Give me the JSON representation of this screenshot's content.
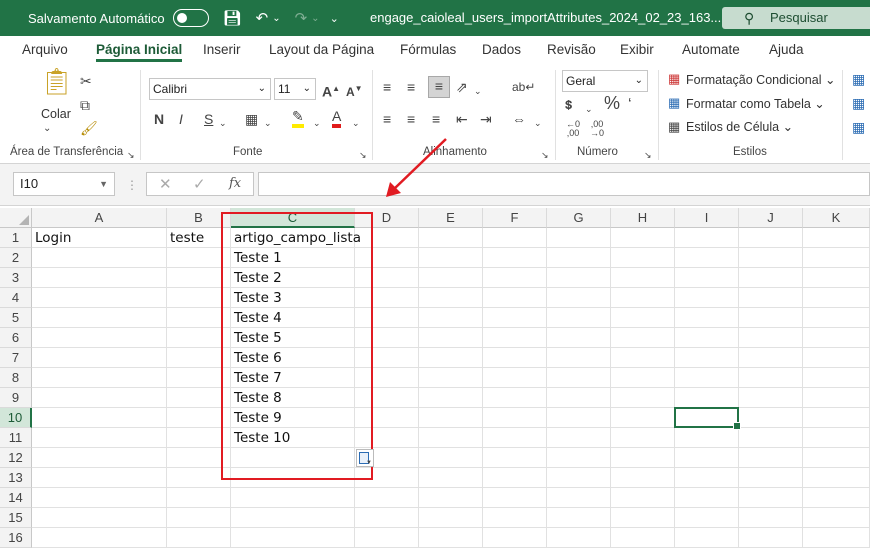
{
  "titlebar": {
    "autosave_label": "Salvamento Automático",
    "doc_title": "engage_caioleal_users_importAttributes_2024_02_23_163...",
    "search_placeholder": "Pesquisar",
    "color": "#217346"
  },
  "menu": {
    "tabs": [
      "Arquivo",
      "Página Inicial",
      "Inserir",
      "Layout da Página",
      "Fórmulas",
      "Dados",
      "Revisão",
      "Exibir",
      "Automate",
      "Ajuda"
    ],
    "active": "Página Inicial"
  },
  "ribbon": {
    "clipboard": {
      "paste_label": "Colar",
      "group_label": "Área de Transferência"
    },
    "font": {
      "name": "Calibri",
      "size": "11",
      "group_label": "Fonte",
      "bold": "N",
      "italic": "I",
      "underline": "S"
    },
    "alignment": {
      "group_label": "Alinhamento"
    },
    "number": {
      "format": "Geral",
      "group_label": "Número",
      "percent": "%"
    },
    "styles": {
      "conditional": "Formatação Condicional",
      "as_table": "Formatar como Tabela",
      "cell_styles": "Estilos de Célula",
      "group_label": "Estilos"
    }
  },
  "formula_bar": {
    "name_box": "I10",
    "fx": "fx",
    "value": ""
  },
  "sheet": {
    "columns": [
      "A",
      "B",
      "C",
      "D",
      "E",
      "F",
      "G",
      "H",
      "I",
      "J",
      "K"
    ],
    "rows": [
      "1",
      "2",
      "3",
      "4",
      "5",
      "6",
      "7",
      "8",
      "9",
      "10",
      "11",
      "12",
      "13",
      "14",
      "15",
      "16"
    ],
    "cells": {
      "A1": "Login",
      "B1": "teste",
      "C1": "artigo_campo_lista",
      "C2": "Teste 1",
      "C3": "Teste 2",
      "C4": "Teste 3",
      "C5": "Teste 4",
      "C6": "Teste 5",
      "C7": "Teste 6",
      "C8": "Teste 7",
      "C9": "Teste 8",
      "C10": "Teste 9",
      "C11": "Teste 10"
    },
    "selected_cell": "I10",
    "highlighted_column": "C",
    "highlighted_row": "10"
  },
  "annotation": {
    "color": "#e11b22"
  }
}
